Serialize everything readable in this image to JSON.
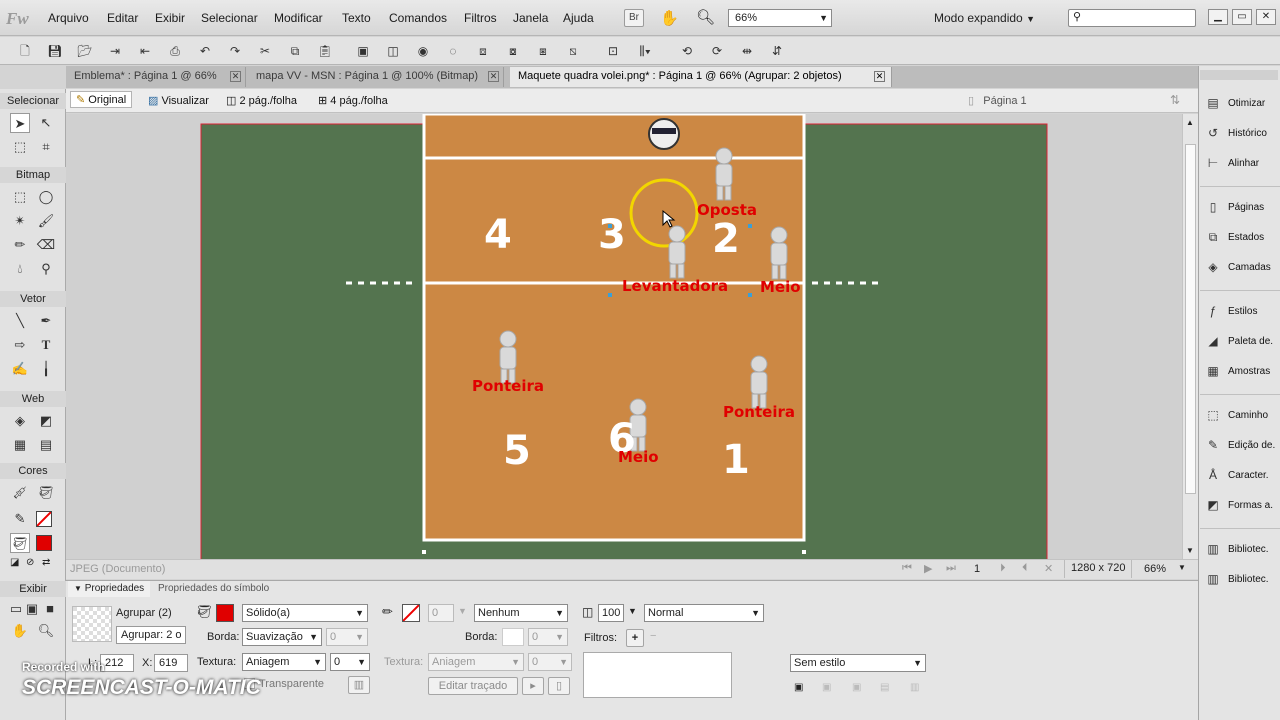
{
  "app": {
    "logo": "Fw",
    "menu": [
      "Arquivo",
      "Editar",
      "Exibir",
      "Selecionar",
      "Modificar",
      "Texto",
      "Comandos",
      "Filtros",
      "Janela",
      "Ajuda"
    ],
    "bridge_btn": "Br",
    "zoom": "66%",
    "workspace": "Modo expandido"
  },
  "tabs": [
    {
      "label": "Emblema* : Página 1 @  66%"
    },
    {
      "label": "mapa VV - MSN : Página 1 @ 100% (Bitmap)"
    },
    {
      "label": "Maquete quadra volei.png* : Página 1 @  66% (Agrupar: 2 objetos)"
    }
  ],
  "viewbar": {
    "original": "Original",
    "preview": "Visualizar",
    "two_up": "2 pág./folha",
    "four_up": "4 pág./folha",
    "page": "Página 1"
  },
  "tools": {
    "select": "Selecionar",
    "bitmap": "Bitmap",
    "vector": "Vetor",
    "web": "Web",
    "colors": "Cores",
    "view": "Exibir"
  },
  "court": {
    "zone_numbers": [
      "4",
      "3",
      "2",
      "5",
      "6",
      "1"
    ],
    "roles": [
      "Oposta",
      "Levantadora",
      "Meio",
      "Ponteira",
      "Ponteira",
      "Meio"
    ],
    "colors": {
      "outer": "#54744f",
      "court": "#cc8844",
      "line": "#ffffff",
      "role": "#e00000"
    }
  },
  "status": {
    "doc_type": "JPEG (Documento)",
    "page_num": "1",
    "size": "1280 x 720",
    "zoom": "66%"
  },
  "props": {
    "tab1": "Propriedades",
    "tab2": "Propriedades do símbolo",
    "object": "Agrupar (2)",
    "object_name": "Agrupar: 2 o",
    "fill_type": "Sólido(a)",
    "border_label": "Borda:",
    "border_value": "Suavização",
    "border_num": "0",
    "texture_label": "Textura:",
    "texture_value": "Aniagem",
    "texture_num": "0",
    "transparent": "Transparente",
    "stroke_size": "0",
    "stroke_type": "Nenhum",
    "stroke_edge_label": "Borda:",
    "stroke_edge_num": "0",
    "stroke_texture_label": "Textura:",
    "stroke_texture_value": "Aniagem",
    "stroke_texture_num": "0",
    "edit_stroke": "Editar traçado",
    "opacity": "100",
    "blend": "Normal",
    "filters_label": "Filtros:",
    "style": "Sem estilo",
    "w_label": "L:",
    "w_value": "212",
    "x_label": "X:",
    "x_value": "619"
  },
  "panels": [
    {
      "icon": "optimize-icon",
      "label": "Otimizar"
    },
    {
      "icon": "history-icon",
      "label": "Histórico"
    },
    {
      "icon": "align-icon",
      "label": "Alinhar"
    },
    {
      "icon": "pages-icon",
      "label": "Páginas"
    },
    {
      "icon": "states-icon",
      "label": "Estados"
    },
    {
      "icon": "layers-icon",
      "label": "Camadas"
    },
    {
      "icon": "styles-icon",
      "label": "Estilos"
    },
    {
      "icon": "palette-icon",
      "label": "Paleta de."
    },
    {
      "icon": "swatches-icon",
      "label": "Amostras"
    },
    {
      "icon": "path-icon",
      "label": "Caminho"
    },
    {
      "icon": "edit-icon",
      "label": "Edição de."
    },
    {
      "icon": "character-icon",
      "label": "Caracter."
    },
    {
      "icon": "shapes-icon",
      "label": "Formas a."
    },
    {
      "icon": "library-icon",
      "label": "Bibliotec."
    },
    {
      "icon": "library2-icon",
      "label": "Bibliotec."
    }
  ],
  "watermark": {
    "line1": "Recorded with",
    "line2": "SCREENCAST-O-MATIC"
  }
}
